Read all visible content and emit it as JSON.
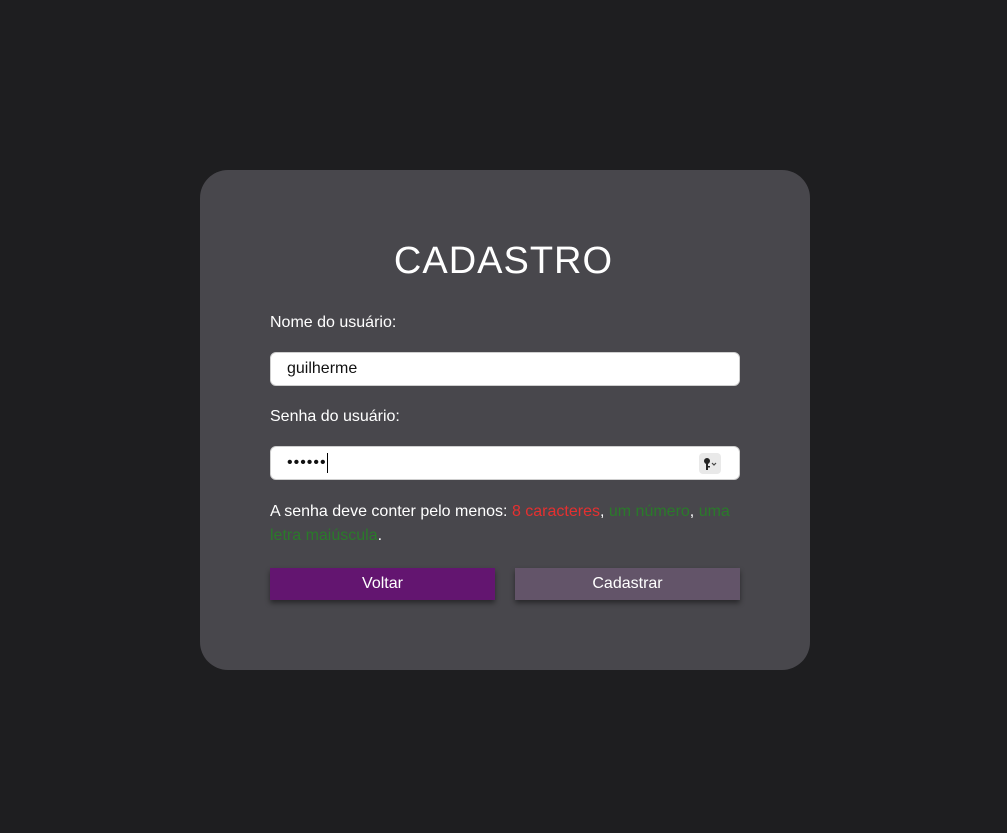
{
  "form": {
    "title": "CADASTRO",
    "username_label": "Nome do usuário:",
    "username_value": "guilherme",
    "password_label": "Senha do usuário:",
    "password_masked": "••••••",
    "password_hint_prefix": "A senha deve conter pelo menos: ",
    "requirements": [
      {
        "text": "8 caracteres",
        "status": "unmet",
        "color": "#e53030"
      },
      {
        "text": "um número",
        "status": "met",
        "color": "#2a7a2a"
      },
      {
        "text": "uma letra maiúscula",
        "status": "met",
        "color": "#2a7a2a"
      }
    ],
    "separator": ", ",
    "end_punct": ".",
    "back_button": "Voltar",
    "submit_button": "Cadastrar"
  },
  "icons": {
    "password_manager": "key-icon"
  },
  "colors": {
    "background": "#1e1e20",
    "card": "#48474c",
    "back_button": "#631570",
    "submit_button": "#635469"
  }
}
